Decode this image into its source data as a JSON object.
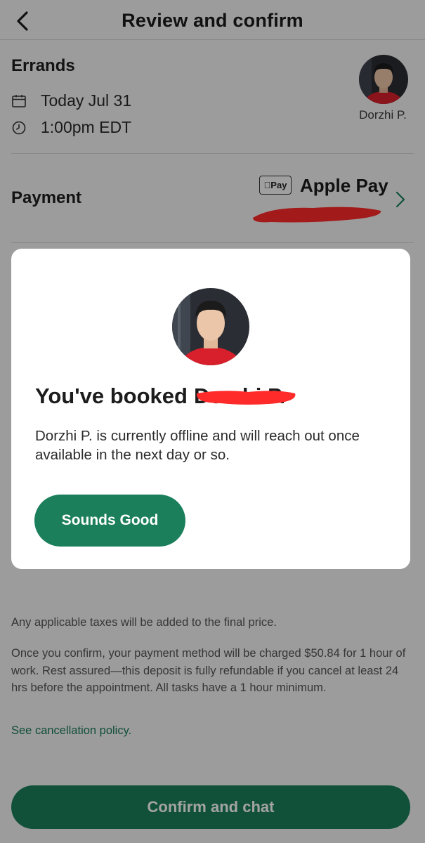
{
  "header": {
    "title": "Review and confirm"
  },
  "booking": {
    "task": "Errands",
    "date": "Today Jul 31",
    "time": "1:00pm EDT",
    "tasker_name": "Dorzhi P."
  },
  "payment": {
    "label": "Payment",
    "badge": "Pay",
    "method": "Apple Pay"
  },
  "notes": {
    "tax": "Any applicable taxes will be added to the final price.",
    "charge": "Once you confirm, your payment method will be charged $50.84 for 1 hour of work. Rest assured—this deposit is fully refundable if you cancel at least 24 hrs before the appointment. All tasks have a 1 hour minimum.",
    "cancellation_link": "See cancellation policy."
  },
  "actions": {
    "confirm_label": "Confirm and chat"
  },
  "modal": {
    "title_prefix": "You've booked",
    "title_name": "Dorzhi P.",
    "body": "Dorzhi P. is currently offline and will reach out once available in the next day or so.",
    "button_label": "Sounds Good"
  },
  "colors": {
    "brand_green": "#1b7f5c",
    "redaction_red": "#ff2a2a",
    "background": "#f4f4f4"
  },
  "icons": {
    "back": "chevron-left-icon",
    "date": "calendar-icon",
    "time": "clock-icon",
    "payment_chevron": "chevron-right-icon"
  }
}
